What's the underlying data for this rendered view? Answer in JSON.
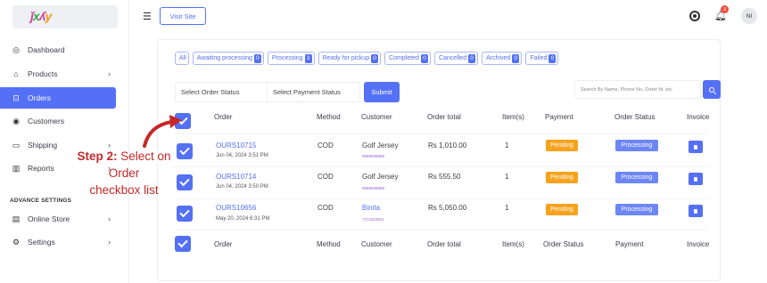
{
  "sidebar": {
    "logo_text": "ǰxʎy",
    "items": [
      {
        "label": "Dashboard",
        "icon": "dashboard-icon",
        "chevron": false,
        "active": false
      },
      {
        "label": "Products",
        "icon": "products-icon",
        "chevron": true,
        "active": false
      },
      {
        "label": "Orders",
        "icon": "cart-icon",
        "chevron": false,
        "active": true
      },
      {
        "label": "Customers",
        "icon": "customers-icon",
        "chevron": false,
        "active": false
      },
      {
        "label": "Shipping",
        "icon": "truck-icon",
        "chevron": true,
        "active": false
      },
      {
        "label": "Reports",
        "icon": "chart-icon",
        "chevron": true,
        "active": false
      }
    ],
    "advance_label": "ADVANCE SETTINGS",
    "advance_items": [
      {
        "label": "Online Store",
        "icon": "store-icon",
        "chevron": true
      },
      {
        "label": "Settings",
        "icon": "gear-icon",
        "chevron": true
      }
    ]
  },
  "topbar": {
    "visit_site": "Visit Site",
    "notification_count": "3",
    "avatar_initials": "NI"
  },
  "filters": [
    {
      "label": "All",
      "count": ""
    },
    {
      "label": "Awaiting processing",
      "count": "0"
    },
    {
      "label": "Processing",
      "count": "3"
    },
    {
      "label": "Ready for pickup",
      "count": "0"
    },
    {
      "label": "Completed",
      "count": "0"
    },
    {
      "label": "Cancelled",
      "count": "0"
    },
    {
      "label": "Archived",
      "count": "0"
    },
    {
      "label": "Failed",
      "count": "0"
    }
  ],
  "controls": {
    "order_status": "Select Order Status",
    "payment_status": "Select Payment Status",
    "submit": "Submit",
    "search_placeholder": "Search By Name, Phone No, Order Id, etc"
  },
  "table": {
    "headers": [
      "Order",
      "Method",
      "Customer",
      "Order total",
      "Item(s)",
      "Payment",
      "Order Status",
      "Invoice"
    ],
    "footer_headers": [
      "Order",
      "Method",
      "Customer",
      "Order total",
      "Item(s)",
      "Order Status",
      "Payment",
      "Invoice"
    ],
    "rows": [
      {
        "order_id": "OURS10715",
        "date": "Jun 04, 2024 3:51 PM",
        "method": "COD",
        "customer": "Golf Jersey",
        "phone": "9888888888",
        "total": "Rs 1,010.00",
        "items": "1",
        "payment": "Pending",
        "status": "Processing"
      },
      {
        "order_id": "OURS10714",
        "date": "Jun 04, 2024 3:50 PM",
        "method": "COD",
        "customer": "Golf Jersey",
        "phone": "9888888888",
        "total": "Rs 555.50",
        "items": "1",
        "payment": "Pending",
        "status": "Processing"
      },
      {
        "order_id": "OURS10656",
        "date": "May 20, 2024 6:31 PM",
        "method": "COD",
        "customer": "Binita",
        "phone": "7271818911",
        "total": "Rs 5,050.00",
        "items": "1",
        "payment": "Pending",
        "status": "Processing"
      }
    ]
  },
  "annotation": {
    "step": "Step 2:",
    "line1": "Select on",
    "line2": "Order",
    "line3": "checkbox list"
  },
  "colors": {
    "accent": "#5470f5",
    "pending": "#f5a21d",
    "processing": "#6d86f5",
    "annotation": "#c62828"
  }
}
